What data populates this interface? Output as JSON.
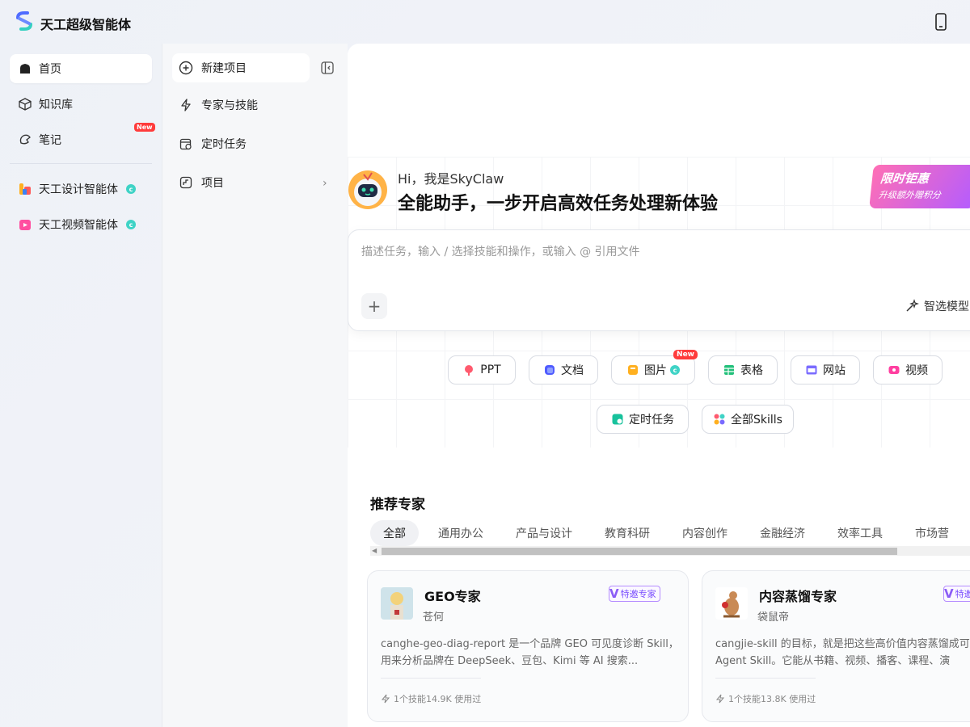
{
  "app": {
    "title": "天工超级智能体"
  },
  "sidebar": {
    "items": [
      {
        "label": "首页",
        "icon": "home-icon"
      },
      {
        "label": "知识库",
        "icon": "cube-icon"
      },
      {
        "label": "笔记",
        "icon": "note-icon",
        "badge": "New"
      }
    ],
    "agents": [
      {
        "label": "天工设计智能体",
        "icon": "design-agent-icon"
      },
      {
        "label": "天工视频智能体",
        "icon": "video-agent-icon"
      }
    ]
  },
  "panel2": {
    "items": [
      {
        "label": "新建项目",
        "icon": "plus-circle-icon"
      },
      {
        "label": "专家与技能",
        "icon": "lightning-icon"
      },
      {
        "label": "定时任务",
        "icon": "calendar-clock-icon"
      },
      {
        "label": "项目",
        "icon": "project-icon"
      }
    ]
  },
  "main": {
    "greeting": "Hi，我是SkyClaw",
    "headline": "全能助手，一步开启高效任务处理新体验",
    "promo": {
      "line1": "限时钜惠",
      "line2": "升级额外赠积分"
    },
    "input_placeholder": "描述任务，输入 / 选择技能和操作，或输入 @ 引用文件",
    "plus_label": "+",
    "model_label": "智选模型",
    "chips": [
      {
        "label": "PPT",
        "icon": "ppt-icon"
      },
      {
        "label": "文档",
        "icon": "doc-icon"
      },
      {
        "label": "图片",
        "icon": "image-icon",
        "badge": "New"
      },
      {
        "label": "表格",
        "icon": "table-icon"
      },
      {
        "label": "网站",
        "icon": "website-icon"
      },
      {
        "label": "视频",
        "icon": "video-icon"
      },
      {
        "label": "定时任务",
        "icon": "schedule-icon"
      },
      {
        "label": "全部Skills",
        "icon": "skills-icon"
      }
    ],
    "recommend_title": "推荐专家",
    "tabs": [
      "全部",
      "通用办公",
      "产品与设计",
      "教育科研",
      "内容创作",
      "金融经济",
      "效率工具",
      "市场营"
    ],
    "cards": [
      {
        "name": "GEO专家",
        "author": "苍何",
        "badge": "特邀专家",
        "desc": "canghe-geo-diag-report 是一个品牌 GEO 可见度诊断 Skill，用来分析品牌在 DeepSeek、豆包、Kimi 等 AI 搜索...",
        "meta": "1个技能14.9K 使用过"
      },
      {
        "name": "内容蒸馏专家",
        "author": "袋鼠帝",
        "badge": "特邀专家",
        "desc": "cangjie-skill 的目标，就是把这些高价值内容蒸馏成可复用的 Agent Skill。它能从书籍、视频、播客、课程、演",
        "meta": "1个技能13.8K 使用过"
      }
    ]
  },
  "colors": {
    "accent": "#7a4dff",
    "badge_red": "#ff3b3b",
    "teal": "#3fd3c6"
  }
}
